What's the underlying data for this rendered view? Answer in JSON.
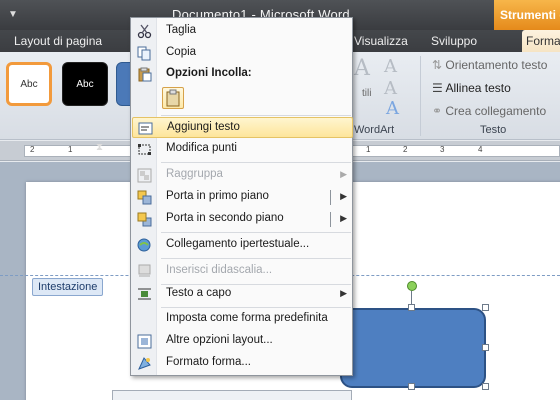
{
  "window": {
    "title": "Documento1  -  Microsoft Word",
    "context_tab_group": "Strumenti di",
    "tabs": [
      {
        "label": "Layout di pagina"
      },
      {
        "label": "Visualizza"
      },
      {
        "label": "Sviluppo"
      }
    ],
    "active_tab": "Formato"
  },
  "ribbon": {
    "style_samples": [
      {
        "label": "Abc"
      },
      {
        "label": "Abc"
      }
    ],
    "wordart_group": "WordArt",
    "text_group": "Testo",
    "text_items": [
      {
        "label": "Orientamento testo"
      },
      {
        "label": "Allinea testo"
      },
      {
        "label": "Crea collegamento"
      }
    ],
    "stili_label": "tili"
  },
  "ruler": {
    "numbers": [
      "2",
      "1",
      "1",
      "2",
      "3",
      "4"
    ]
  },
  "document": {
    "header_tag": "Intestazione"
  },
  "context_menu": {
    "items": [
      {
        "label": "Taglia",
        "icon": "scissors-icon",
        "enabled": true
      },
      {
        "label": "Copia",
        "icon": "copy-icon",
        "enabled": true
      },
      {
        "label": "Opzioni Incolla:",
        "icon": "paste-icon",
        "enabled": true
      },
      {
        "label": "Aggiungi testo",
        "icon": "text-box-icon",
        "enabled": true,
        "highlighted": true
      },
      {
        "label": "Modifica punti",
        "icon": "edit-points-icon",
        "enabled": true
      },
      {
        "label": "Raggruppa",
        "icon": "group-icon",
        "enabled": false
      },
      {
        "label": "Porta in primo piano",
        "icon": "bring-front-icon",
        "enabled": true
      },
      {
        "label": "Porta in secondo piano",
        "icon": "send-back-icon",
        "enabled": true
      },
      {
        "label": "Collegamento ipertestuale...",
        "icon": "hyperlink-icon",
        "enabled": true
      },
      {
        "label": "Inserisci didascalia...",
        "icon": "caption-icon",
        "enabled": false
      },
      {
        "label": "Testo a capo",
        "icon": "wrap-text-icon",
        "enabled": true
      },
      {
        "label": "Imposta come forma predefinita",
        "icon": "",
        "enabled": true
      },
      {
        "label": "Altre opzioni layout...",
        "icon": "layout-options-icon",
        "enabled": true
      },
      {
        "label": "Formato forma...",
        "icon": "format-shape-icon",
        "enabled": true
      }
    ]
  },
  "colors": {
    "context_tab": "#f0a030",
    "shape_fill": "#4e7fc1",
    "highlight": "#fde59b"
  }
}
